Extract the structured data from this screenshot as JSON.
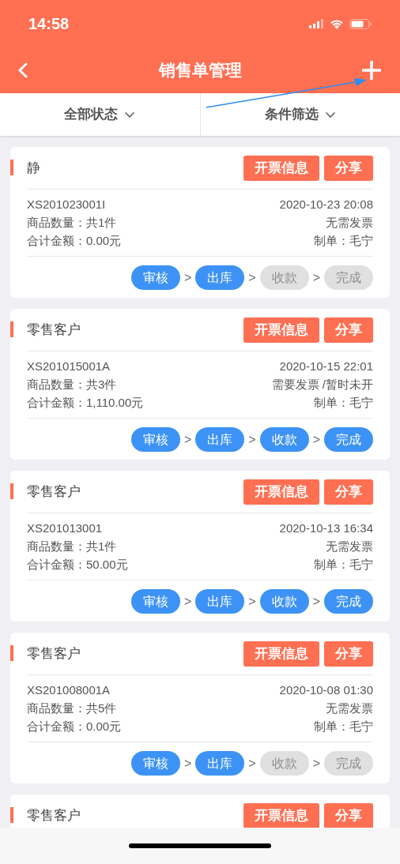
{
  "status_bar": {
    "time": "14:58"
  },
  "nav": {
    "title": "销售单管理"
  },
  "filters": [
    {
      "label": "全部状态"
    },
    {
      "label": "条件筛选"
    }
  ],
  "orders": [
    {
      "customer": "静",
      "buttons": [
        "开票信息",
        "分享"
      ],
      "number": "XS201023001I",
      "datetime": "2020-10-23 20:08",
      "quantity": "商品数量：共1件",
      "invoice": "无需发票",
      "amount": "合计金额：0.00元",
      "maker": "制单：毛宁",
      "steps": [
        {
          "label": "审核",
          "done": true
        },
        {
          "prefix": ">",
          "label": "出库",
          "done": true
        },
        {
          "prefix": ">",
          "label": "收款",
          "done": false
        },
        {
          "prefix": ">",
          "label": "完成",
          "done": false
        }
      ]
    },
    {
      "customer": "零售客户",
      "buttons": [
        "开票信息",
        "分享"
      ],
      "number": "XS201015001A",
      "datetime": "2020-10-15 22:01",
      "quantity": "商品数量：共3件",
      "invoice": "需要发票 /暂时未开",
      "amount": "合计金额：1,110.00元",
      "maker": "制单：毛宁",
      "steps": [
        {
          "label": "审核",
          "done": true
        },
        {
          "prefix": ">",
          "label": "出库",
          "done": true
        },
        {
          "prefix": ">",
          "label": "收款",
          "done": true
        },
        {
          "prefix": ">",
          "label": "完成",
          "done": true
        }
      ]
    },
    {
      "customer": "零售客户",
      "buttons": [
        "开票信息",
        "分享"
      ],
      "number": "XS201013001",
      "datetime": "2020-10-13 16:34",
      "quantity": "商品数量：共1件",
      "invoice": "无需发票",
      "amount": "合计金额：50.00元",
      "maker": "制单：毛宁",
      "steps": [
        {
          "label": "审核",
          "done": true
        },
        {
          "prefix": ">",
          "label": "出库",
          "done": true
        },
        {
          "prefix": ">",
          "label": "收款",
          "done": true
        },
        {
          "prefix": ">",
          "label": "完成",
          "done": true
        }
      ]
    },
    {
      "customer": "零售客户",
      "buttons": [
        "开票信息",
        "分享"
      ],
      "number": "XS201008001A",
      "datetime": "2020-10-08 01:30",
      "quantity": "商品数量：共5件",
      "invoice": "无需发票",
      "amount": "合计金额：0.00元",
      "maker": "制单：毛宁",
      "steps": [
        {
          "label": "审核",
          "done": true
        },
        {
          "prefix": ">",
          "label": "出库",
          "done": true
        },
        {
          "prefix": ">",
          "label": "收款",
          "done": false
        },
        {
          "prefix": ">",
          "label": "完成",
          "done": false
        }
      ]
    },
    {
      "customer": "零售客户",
      "buttons": [
        "开票信息",
        "分享"
      ]
    }
  ]
}
